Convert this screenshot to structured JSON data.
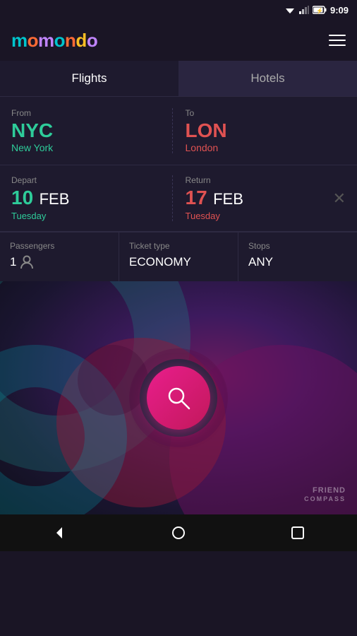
{
  "statusBar": {
    "time": "9:09"
  },
  "header": {
    "logo": "momondo",
    "menuLabel": "Menu"
  },
  "tabs": [
    {
      "id": "flights",
      "label": "Flights",
      "active": true
    },
    {
      "id": "hotels",
      "label": "Hotels",
      "active": false
    }
  ],
  "from": {
    "label": "From",
    "code": "NYC",
    "city": "New York"
  },
  "to": {
    "label": "To",
    "code": "LON",
    "city": "London"
  },
  "depart": {
    "label": "Depart",
    "day": "10",
    "month": "FEB",
    "weekday": "Tuesday"
  },
  "return": {
    "label": "Return",
    "day": "17",
    "month": "FEB",
    "weekday": "Tuesday"
  },
  "passengers": {
    "label": "Passengers",
    "count": "1"
  },
  "ticketType": {
    "label": "Ticket type",
    "value": "ECONOMY"
  },
  "stops": {
    "label": "Stops",
    "value": "ANY"
  },
  "searchButton": {
    "label": "Search"
  },
  "watermark": {
    "line1": "FRIEND",
    "line2": "COMPASS"
  },
  "navBar": {
    "back": "◁",
    "home": "○",
    "recents": "□"
  }
}
